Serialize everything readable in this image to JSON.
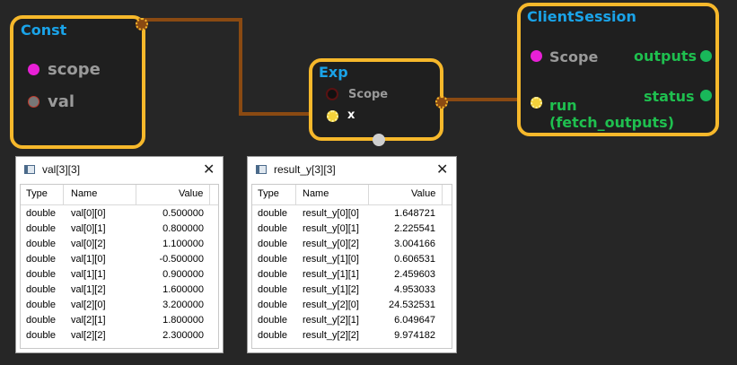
{
  "nodes": {
    "const": {
      "title": "Const",
      "ports": {
        "scope": "scope",
        "val": "val"
      }
    },
    "exp": {
      "title": "Exp",
      "ports": {
        "scope": "Scope",
        "x": "x"
      }
    },
    "client_session": {
      "title": "ClientSession",
      "inputs": {
        "scope": "Scope",
        "run_line1": "run",
        "run_line2": "(fetch_outputs)"
      },
      "outputs": {
        "outputs": "outputs",
        "status": "status"
      }
    }
  },
  "colors": {
    "node_border": "#f6b82b",
    "title": "#1aa3e8",
    "scope_port": "#e820d6",
    "flow_wire": "#8a4a12",
    "output_port": "#19b85a",
    "output_label": "#1fbf4f"
  },
  "icons": {
    "window": "window-icon",
    "close": "close-icon"
  },
  "windows": {
    "val": {
      "title": "val[3][3]",
      "close": "✕",
      "columns": [
        "Type",
        "Name",
        "Value"
      ],
      "rows": [
        {
          "type": "double",
          "name": "val[0][0]",
          "value": "0.500000"
        },
        {
          "type": "double",
          "name": "val[0][1]",
          "value": "0.800000"
        },
        {
          "type": "double",
          "name": "val[0][2]",
          "value": "1.100000"
        },
        {
          "type": "double",
          "name": "val[1][0]",
          "value": "-0.500000"
        },
        {
          "type": "double",
          "name": "val[1][1]",
          "value": "0.900000"
        },
        {
          "type": "double",
          "name": "val[1][2]",
          "value": "1.600000"
        },
        {
          "type": "double",
          "name": "val[2][0]",
          "value": "3.200000"
        },
        {
          "type": "double",
          "name": "val[2][1]",
          "value": "1.800000"
        },
        {
          "type": "double",
          "name": "val[2][2]",
          "value": "2.300000"
        }
      ]
    },
    "result_y": {
      "title": "result_y[3][3]",
      "close": "✕",
      "columns": [
        "Type",
        "Name",
        "Value"
      ],
      "rows": [
        {
          "type": "double",
          "name": "result_y[0][0]",
          "value": "1.648721"
        },
        {
          "type": "double",
          "name": "result_y[0][1]",
          "value": "2.225541"
        },
        {
          "type": "double",
          "name": "result_y[0][2]",
          "value": "3.004166"
        },
        {
          "type": "double",
          "name": "result_y[1][0]",
          "value": "0.606531"
        },
        {
          "type": "double",
          "name": "result_y[1][1]",
          "value": "2.459603"
        },
        {
          "type": "double",
          "name": "result_y[1][2]",
          "value": "4.953033"
        },
        {
          "type": "double",
          "name": "result_y[2][0]",
          "value": "24.532531"
        },
        {
          "type": "double",
          "name": "result_y[2][1]",
          "value": "6.049647"
        },
        {
          "type": "double",
          "name": "result_y[2][2]",
          "value": "9.974182"
        }
      ]
    }
  }
}
